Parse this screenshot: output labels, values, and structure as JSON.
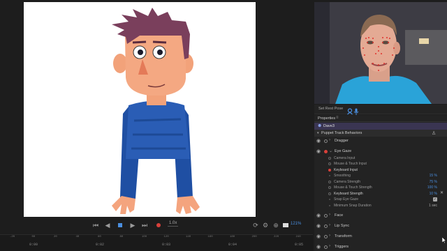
{
  "transport": {
    "speed": "1.0x",
    "zoom": "121%"
  },
  "timeline": {
    "ruler_ticks": [
      "-20",
      "00",
      "20",
      "40",
      "60",
      "80",
      "100",
      "120",
      "140",
      "160",
      "180",
      "200",
      "220",
      "240"
    ],
    "times": [
      "0:00",
      "0:02",
      "0:03",
      "0:04",
      "0:05"
    ]
  },
  "rest_bar": {
    "set_rest_pose": "Set Rest Pose"
  },
  "properties": {
    "title": "Properties",
    "menu": "≡",
    "puppet_name": "Dave3",
    "section": "Puppet Track Behaviors",
    "behaviors": [
      {
        "name": "Dragger"
      },
      {
        "name": "Eye Gaze"
      },
      {
        "name": "Face"
      },
      {
        "name": "Lip Sync"
      },
      {
        "name": "Transform"
      },
      {
        "name": "Triggers"
      }
    ],
    "eye_gaze_params": [
      {
        "label": "Camera Input",
        "value": ""
      },
      {
        "label": "Mouse & Touch Input",
        "value": ""
      },
      {
        "label": "Keyboard Input",
        "value": ""
      },
      {
        "label": "Smoothing",
        "value": "15 %"
      },
      {
        "label": "Camera Strength",
        "value": "75 %"
      },
      {
        "label": "Mouse & Touch Strength",
        "value": "100 %"
      },
      {
        "label": "Keyboard Strength",
        "value": "10 %"
      },
      {
        "label": "Snap Eye Gaze",
        "value": "✓"
      },
      {
        "label": "Minimum Snap Duration",
        "value": "1 sec"
      }
    ]
  },
  "colors": {
    "accent_blue": "#4a8fe0",
    "record_red": "#d9403a",
    "puppet_row": "#3a3552"
  }
}
